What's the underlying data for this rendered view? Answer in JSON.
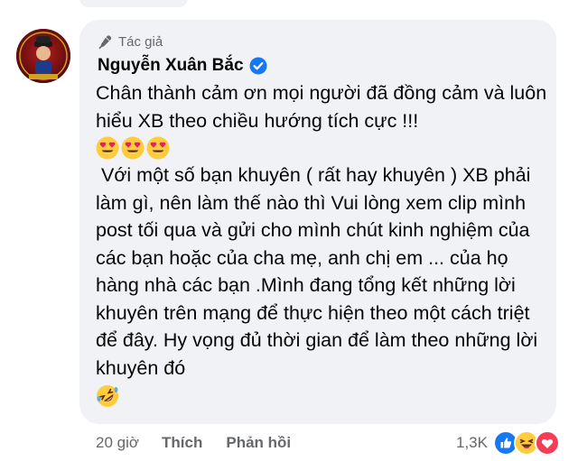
{
  "comment": {
    "badge": "Tác giả",
    "author": "Nguyễn Xuân Bắc",
    "line1": "Chân thành cảm ơn mọi người đã đồng cảm và luôn hiểu XB theo chiều hướng tích cực !!!",
    "line2": " Với một số bạn khuyên ( rất hay khuyên ) XB phải làm gì, nên làm thế nào thì Vui lòng xem clip mình post tối qua và gửi cho mình chút kinh nghiệm của các bạn hoặc của cha mẹ, anh chị em ... của họ hàng nhà các bạn .Mình đang tổng kết những lời khuyên trên mạng để thực hiện theo một cách triệt để đây. Hy vọng đủ thời gian để làm theo những lời khuyên đó",
    "emojis_heart_eyes": [
      "smiling-face-heart-eyes",
      "smiling-face-heart-eyes",
      "smiling-face-heart-eyes"
    ],
    "emoji_end": "rolling-on-floor-laughing"
  },
  "actions": {
    "time": "20 giờ",
    "like": "Thích",
    "reply": "Phản hồi"
  },
  "reactions": {
    "count": "1,3K",
    "icons": [
      "like-icon",
      "laugh-icon",
      "love-icon"
    ]
  },
  "colors": {
    "bubble": "#f0f2f5",
    "secondary_text": "#65676b",
    "verified": "#1877f2"
  }
}
